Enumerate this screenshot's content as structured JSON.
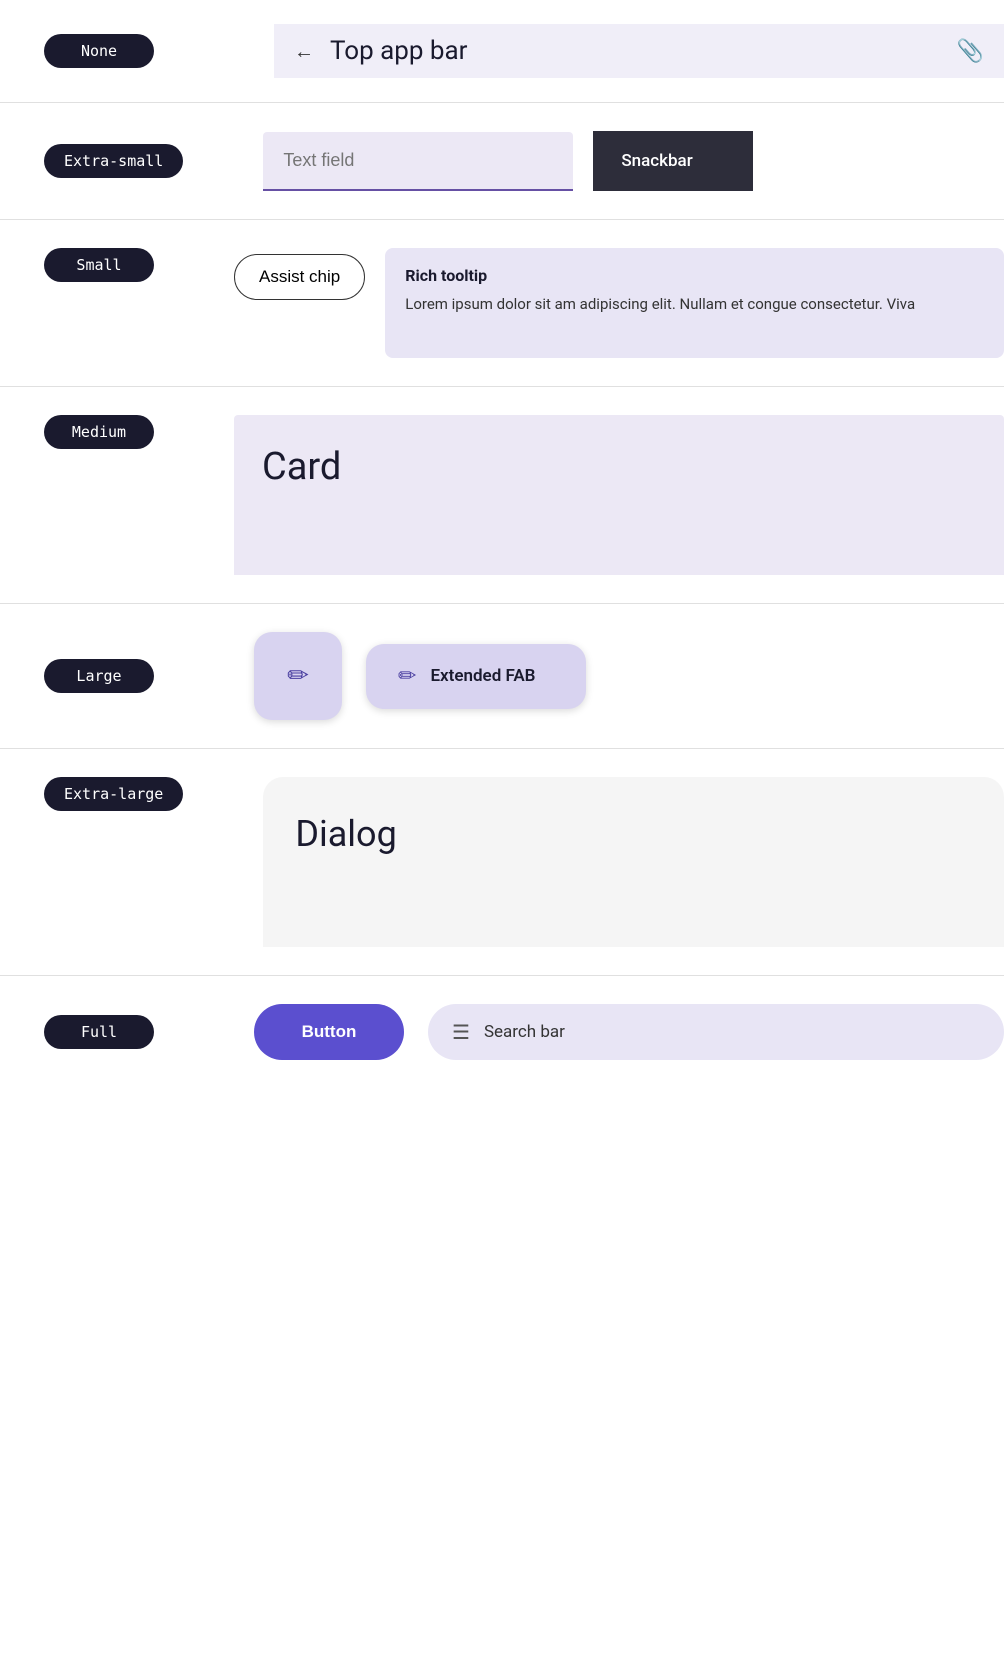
{
  "rows": [
    {
      "id": "row-none",
      "badge": "None",
      "component": "top-app-bar",
      "topAppBar": {
        "backIcon": "←",
        "title": "Top app bar",
        "attachIcon": "📎"
      }
    },
    {
      "id": "row-extra-small",
      "badge": "Extra-small",
      "component": "text-field-snackbar",
      "textField": {
        "placeholder": "Text field"
      },
      "snackbar": {
        "label": "Snackbar"
      }
    },
    {
      "id": "row-small",
      "badge": "Small",
      "component": "assist-chip-tooltip",
      "assistChip": {
        "label": "Assist chip"
      },
      "richTooltip": {
        "title": "Rich tooltip",
        "body": "Lorem ipsum dolor sit am adipiscing elit. Nullam et congue consectetur. Viva"
      }
    },
    {
      "id": "row-medium",
      "badge": "Medium",
      "component": "card",
      "card": {
        "title": "Card"
      }
    },
    {
      "id": "row-large",
      "badge": "Large",
      "component": "fab",
      "fab": {
        "icon": "✏",
        "extendedIcon": "✏",
        "extendedLabel": "Extended FAB"
      }
    },
    {
      "id": "row-extra-large",
      "badge": "Extra-large",
      "component": "dialog",
      "dialog": {
        "title": "Dialog"
      }
    },
    {
      "id": "row-full",
      "badge": "Full",
      "component": "button-searchbar",
      "button": {
        "label": "Button"
      },
      "searchBar": {
        "icon": "☰",
        "placeholder": "Search bar"
      }
    }
  ]
}
